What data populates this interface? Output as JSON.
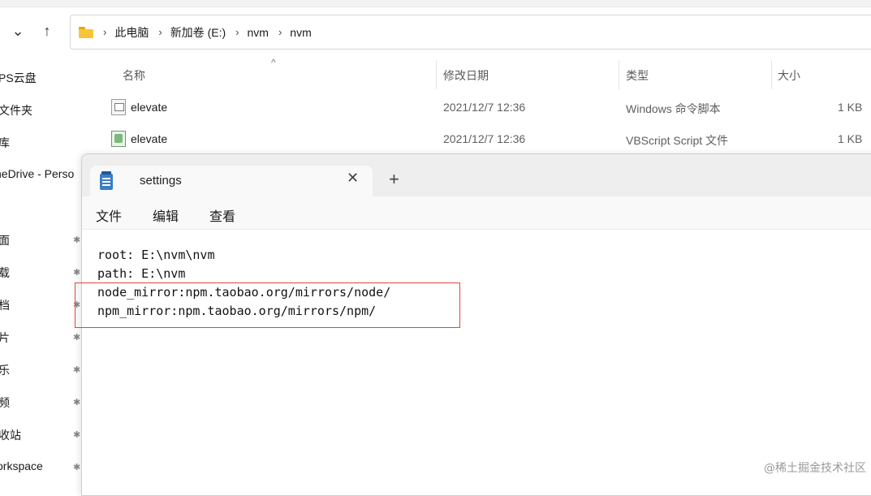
{
  "explorer": {
    "breadcrumb": [
      "此电脑",
      "新加卷 (E:)",
      "nvm",
      "nvm"
    ],
    "sidebar": [
      {
        "label": "PS云盘",
        "pinned": false
      },
      {
        "label": "文件夹",
        "pinned": false
      },
      {
        "label": "库",
        "pinned": false
      },
      {
        "label": "neDrive - Perso",
        "pinned": false
      },
      {
        "label": "面",
        "pinned": true
      },
      {
        "label": "载",
        "pinned": true
      },
      {
        "label": "档",
        "pinned": true
      },
      {
        "label": "片",
        "pinned": true
      },
      {
        "label": "乐",
        "pinned": true
      },
      {
        "label": "频",
        "pinned": true
      },
      {
        "label": "收站",
        "pinned": true
      },
      {
        "label": "orkspace",
        "pinned": true
      }
    ],
    "columns": {
      "name": "名称",
      "date": "修改日期",
      "type": "类型",
      "size": "大小"
    },
    "files": [
      {
        "name": "elevate",
        "date": "2021/12/7 12:36",
        "type": "Windows 命令脚本",
        "size": "1 KB",
        "icon": "batch-file-icon"
      },
      {
        "name": "elevate",
        "date": "2021/12/7 12:36",
        "type": "VBScript Script 文件",
        "size": "1 KB",
        "icon": "vbscript-file-icon"
      }
    ]
  },
  "notepad": {
    "tab_title": "settings",
    "new_tab": "+",
    "close": "✕",
    "menu": [
      "文件",
      "编辑",
      "查看"
    ],
    "lines": [
      "root: E:\\nvm\\nvm",
      "path: E:\\nvm",
      "node_mirror:npm.taobao.org/mirrors/node/",
      "npm_mirror:npm.taobao.org/mirrors/npm/"
    ]
  },
  "watermark": "@稀土掘金技术社区",
  "colors": {
    "highlight": "#e0443c",
    "folder": "#f8c53a",
    "notepad_icon": "#3a7fc4"
  }
}
